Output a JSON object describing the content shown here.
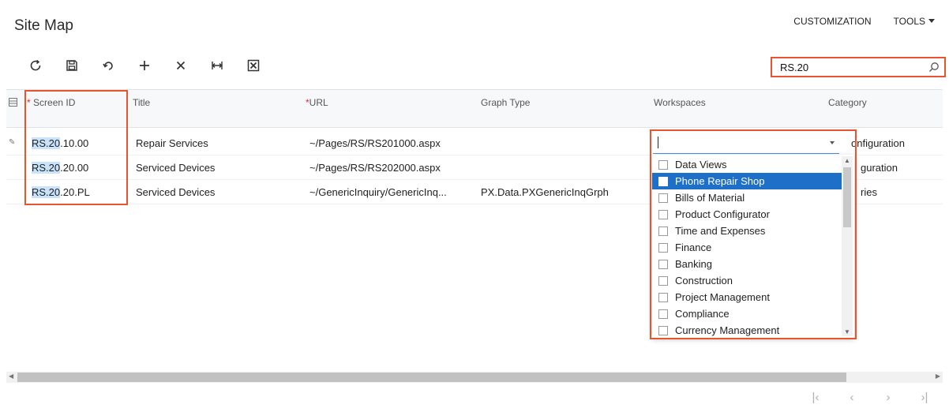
{
  "header": {
    "title": "Site Map",
    "customization": "CUSTOMIZATION",
    "tools": "TOOLS"
  },
  "toolbar": {
    "buttons": [
      "refresh-icon",
      "save-icon",
      "undo-icon",
      "add-icon",
      "delete-icon",
      "fit-columns-icon",
      "export-excel-icon"
    ]
  },
  "search": {
    "value": "RS.20"
  },
  "table": {
    "columns": {
      "screen_id": "Screen ID",
      "title": "Title",
      "url": "URL",
      "graph_type": "Graph Type",
      "workspaces": "Workspaces",
      "category": "Category"
    },
    "rows": [
      {
        "id_match": "RS.20",
        "id_rest": ".10.00",
        "title": "Repair Services",
        "url": "~/Pages/RS/RS201000.aspx",
        "graph_type": "",
        "category": "onfiguration"
      },
      {
        "id_match": "RS.20",
        "id_rest": ".20.00",
        "title": "Serviced Devices",
        "url": "~/Pages/RS/RS202000.aspx",
        "graph_type": "",
        "category": "guration"
      },
      {
        "id_match": "RS.20",
        "id_rest": ".20.PL",
        "title": "Serviced Devices",
        "url": "~/GenericInquiry/GenericInq...",
        "graph_type": "PX.Data.PXGenericInqGrph",
        "category": "ries"
      }
    ]
  },
  "workspaces_dropdown": {
    "value": "",
    "selected": "Phone Repair Shop",
    "options": [
      "Data Views",
      "Phone Repair Shop",
      "Bills of Material",
      "Product Configurator",
      "Time and Expenses",
      "Finance",
      "Banking",
      "Construction",
      "Project Management",
      "Compliance",
      "Currency Management"
    ]
  },
  "colors": {
    "highlight_box": "#e8542e",
    "search_match": "#c9e4fa",
    "selected_option": "#1e6fc8",
    "required_star": "#e02b2b"
  }
}
